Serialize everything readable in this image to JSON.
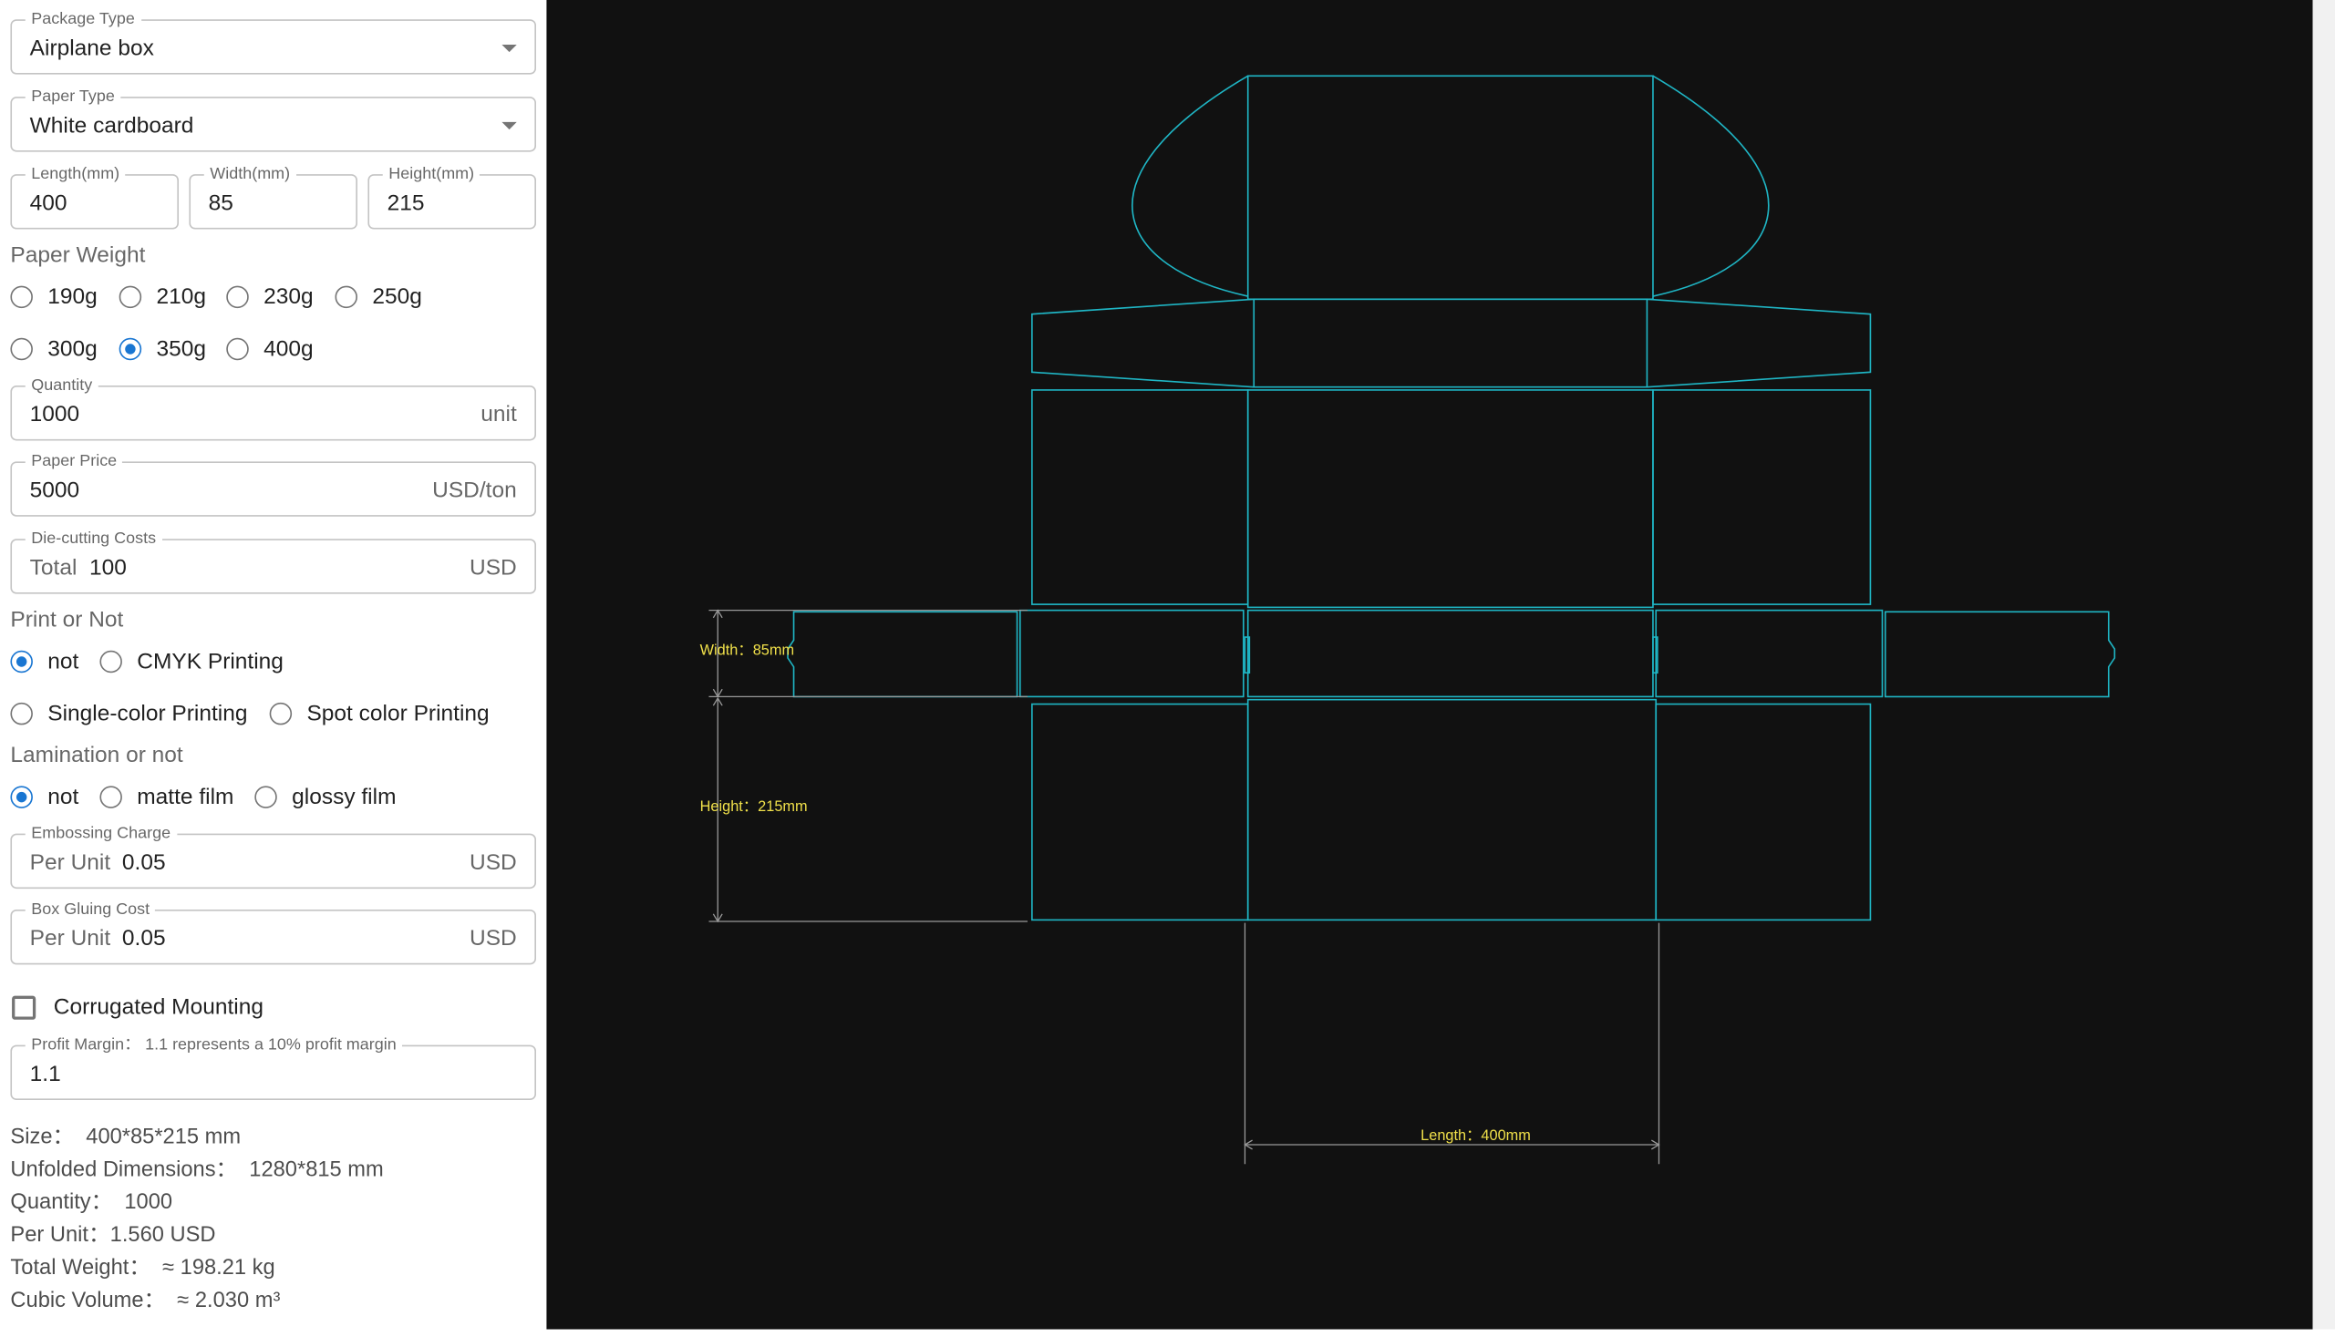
{
  "form": {
    "package_type": {
      "label": "Package Type",
      "value": "Airplane box"
    },
    "paper_type": {
      "label": "Paper Type",
      "value": "White cardboard"
    },
    "length": {
      "label": "Length(mm)",
      "value": "400"
    },
    "width": {
      "label": "Width(mm)",
      "value": "85"
    },
    "height": {
      "label": "Height(mm)",
      "value": "215"
    },
    "paper_weight": {
      "label": "Paper Weight",
      "options": [
        "190g",
        "210g",
        "230g",
        "250g",
        "300g",
        "350g",
        "400g"
      ],
      "selected": "350g"
    },
    "quantity": {
      "label": "Quantity",
      "value": "1000",
      "suffix": "unit"
    },
    "paper_price": {
      "label": "Paper Price",
      "value": "5000",
      "suffix": "USD/ton"
    },
    "die_cutting": {
      "label": "Die-cutting Costs",
      "prefix": "Total",
      "value": "100",
      "suffix": "USD"
    },
    "print": {
      "label": "Print or Not",
      "options": [
        "not",
        "CMYK Printing",
        "Single-color Printing",
        "Spot color Printing"
      ],
      "selected": "not"
    },
    "lamination": {
      "label": "Lamination or not",
      "options": [
        "not",
        "matte film",
        "glossy film"
      ],
      "selected": "not"
    },
    "embossing": {
      "label": "Embossing Charge",
      "prefix": "Per Unit",
      "value": "0.05",
      "suffix": "USD"
    },
    "gluing": {
      "label": "Box Gluing Cost",
      "prefix": "Per Unit",
      "value": "0.05",
      "suffix": "USD"
    },
    "corrugated": {
      "label": "Corrugated Mounting",
      "checked": false
    },
    "profit": {
      "label": "Profit Margin： 1.1 represents a 10% profit margin",
      "value": "1.1"
    }
  },
  "summary": {
    "size": {
      "label": "Size：",
      "value": "400*85*215 mm"
    },
    "unfolded": {
      "label": "Unfolded Dimensions：",
      "value": "1280*815 mm"
    },
    "quantity": {
      "label": "Quantity：",
      "value": "1000"
    },
    "per_unit": {
      "label": "Per Unit：",
      "value": "1.560 USD"
    },
    "weight": {
      "label": "Total Weight：",
      "value": "≈ 198.21 kg"
    },
    "volume": {
      "label": "Cubic Volume：",
      "value": "≈ 2.030 m³"
    }
  },
  "dieline": {
    "width_label": "Width：85mm",
    "height_label": "Height：215mm",
    "length_label": "Length：400mm",
    "line_color": "#1fb5c4",
    "dim_color": "#9a9a9a",
    "label_color": "#f0e04a",
    "background": "#111111"
  }
}
